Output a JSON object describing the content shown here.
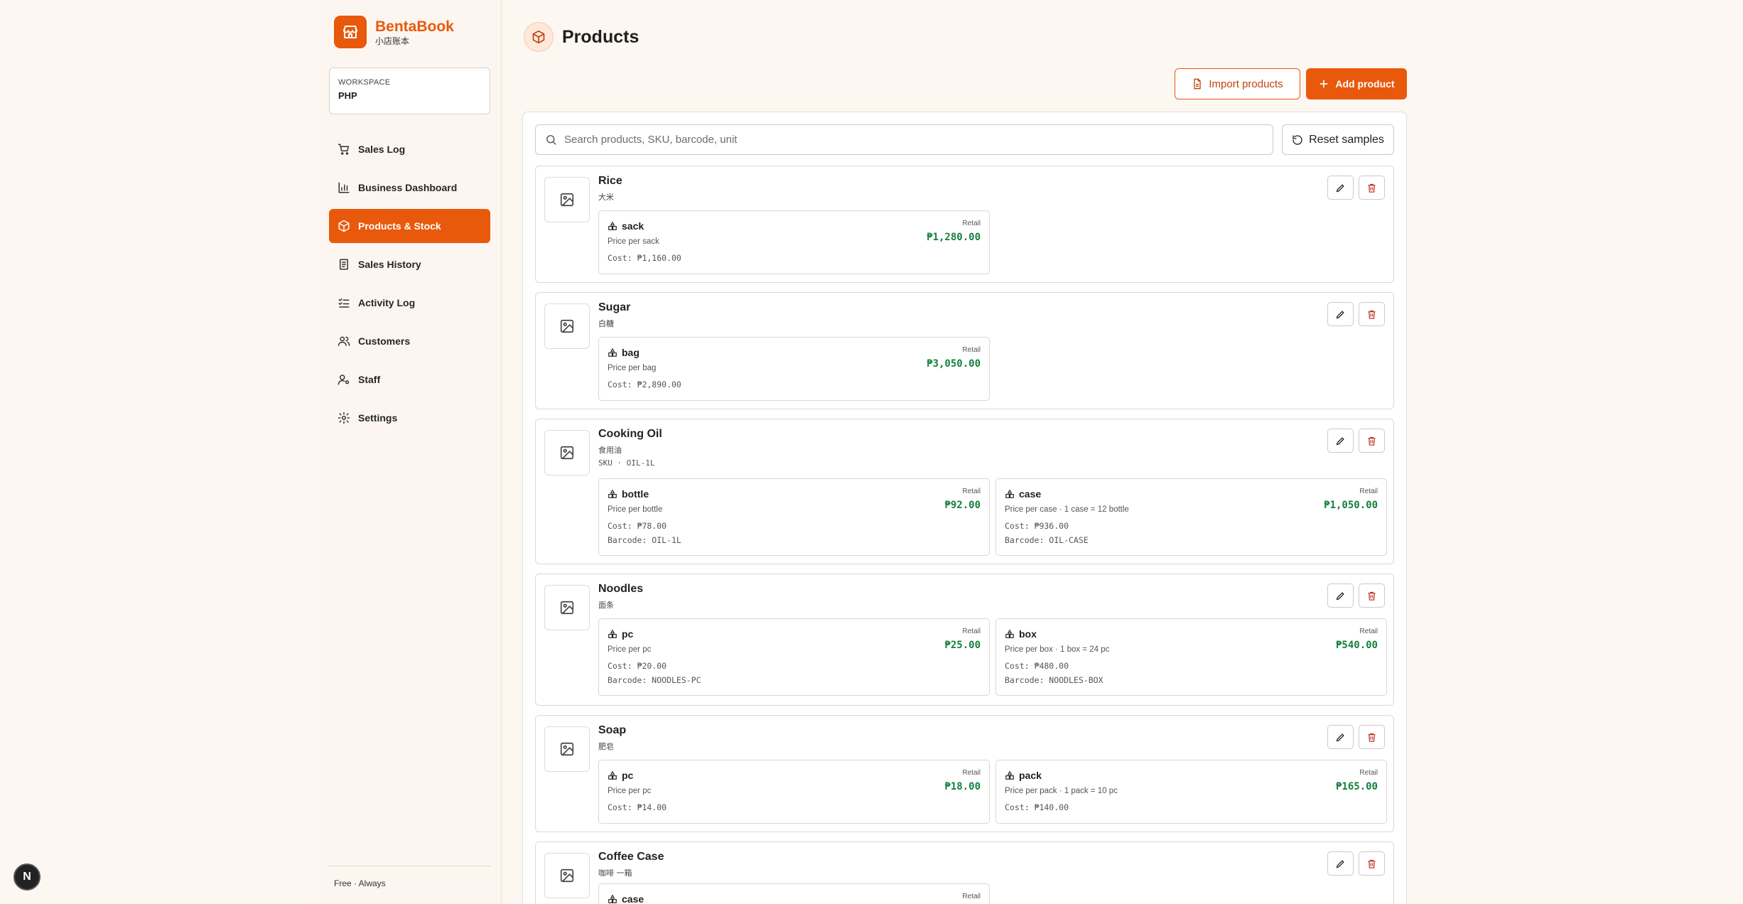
{
  "brand": {
    "name": "BentaBook",
    "subtitle": "小店账本"
  },
  "workspace": {
    "label": "WORKSPACE",
    "value": "PHP"
  },
  "nav": [
    {
      "label": "Sales Log",
      "icon": "cart-icon"
    },
    {
      "label": "Business Dashboard",
      "icon": "bar-chart-icon"
    },
    {
      "label": "Products & Stock",
      "icon": "box-icon",
      "active": true
    },
    {
      "label": "Sales History",
      "icon": "receipt-icon"
    },
    {
      "label": "Activity Log",
      "icon": "checklist-icon"
    },
    {
      "label": "Customers",
      "icon": "users-icon"
    },
    {
      "label": "Staff",
      "icon": "user-key-icon"
    },
    {
      "label": "Settings",
      "icon": "gear-icon"
    }
  ],
  "footer": {
    "text": "Free · Always"
  },
  "page": {
    "title": "Products"
  },
  "actions": {
    "import_label": "Import products",
    "add_label": "Add product",
    "reset_label": "Reset samples"
  },
  "search": {
    "placeholder": "Search products, SKU, barcode, unit"
  },
  "colors": {
    "accent": "#e8590c",
    "price": "#15803d"
  },
  "products": [
    {
      "name": "Rice",
      "alt": "大米",
      "units": [
        {
          "name": "sack",
          "desc": "Price per sack",
          "cost": "Cost: ₱1,160.00",
          "retail_label": "Retail",
          "price": "₱1,280.00"
        }
      ]
    },
    {
      "name": "Sugar",
      "alt": "白糖",
      "units": [
        {
          "name": "bag",
          "desc": "Price per bag",
          "cost": "Cost: ₱2,890.00",
          "retail_label": "Retail",
          "price": "₱3,050.00"
        }
      ]
    },
    {
      "name": "Cooking Oil",
      "alt": "食用油",
      "sku": "SKU · OIL-1L",
      "units": [
        {
          "name": "bottle",
          "desc": "Price per bottle",
          "cost": "Cost: ₱78.00",
          "barcode": "Barcode: OIL-1L",
          "retail_label": "Retail",
          "price": "₱92.00"
        },
        {
          "name": "case",
          "desc": "Price per case · 1 case = 12 bottle",
          "cost": "Cost: ₱936.00",
          "barcode": "Barcode: OIL-CASE",
          "retail_label": "Retail",
          "price": "₱1,050.00"
        }
      ]
    },
    {
      "name": "Noodles",
      "alt": "面条",
      "units": [
        {
          "name": "pc",
          "desc": "Price per pc",
          "cost": "Cost: ₱20.00",
          "barcode": "Barcode: NOODLES-PC",
          "retail_label": "Retail",
          "price": "₱25.00"
        },
        {
          "name": "box",
          "desc": "Price per box · 1 box = 24 pc",
          "cost": "Cost: ₱480.00",
          "barcode": "Barcode: NOODLES-BOX",
          "retail_label": "Retail",
          "price": "₱540.00"
        }
      ]
    },
    {
      "name": "Soap",
      "alt": "肥皂",
      "units": [
        {
          "name": "pc",
          "desc": "Price per pc",
          "cost": "Cost: ₱14.00",
          "retail_label": "Retail",
          "price": "₱18.00"
        },
        {
          "name": "pack",
          "desc": "Price per pack · 1 pack = 10 pc",
          "cost": "Cost: ₱140.00",
          "retail_label": "Retail",
          "price": "₱165.00"
        }
      ]
    },
    {
      "name": "Coffee Case",
      "alt": "咖啡 一箱",
      "units": [
        {
          "name": "case",
          "retail_label": "Retail"
        }
      ]
    }
  ],
  "badge": {
    "letter": "N"
  }
}
